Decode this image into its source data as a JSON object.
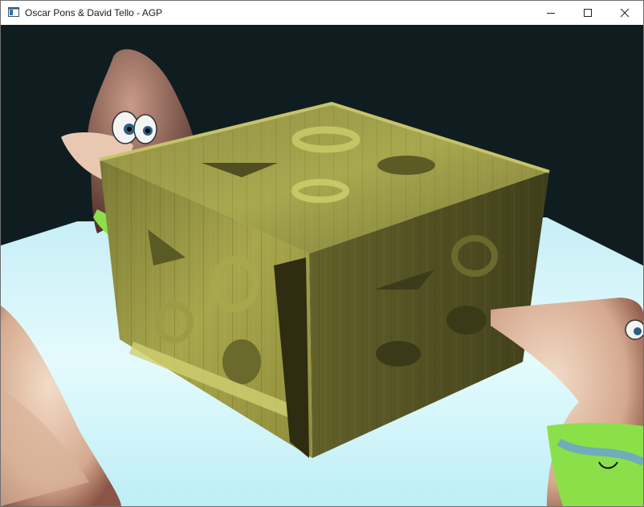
{
  "window": {
    "title": "Oscar Pons & David Tello - AGP"
  },
  "icons": {
    "app": "application-window-icon",
    "minimize": "minimize-icon",
    "maximize": "maximize-icon",
    "close": "close-icon"
  },
  "colors": {
    "sky": "#0f1d20",
    "floor": "#d8f7fb",
    "crate_light": "#9fa047",
    "crate_dark": "#4f4f22",
    "character_skin": "#e9c8b2",
    "character_shorts": "#8be04a"
  }
}
